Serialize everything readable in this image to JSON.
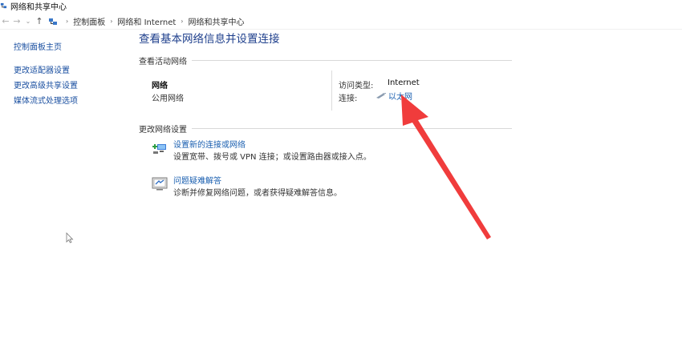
{
  "window": {
    "title": "网络和共享中心"
  },
  "address": {
    "crumbs": [
      "控制面板",
      "网络和 Internet",
      "网络和共享中心"
    ]
  },
  "sidebar": {
    "items": [
      {
        "label": "控制面板主页"
      },
      {
        "label": "更改适配器设置"
      },
      {
        "label": "更改高级共享设置"
      },
      {
        "label": "媒体流式处理选项"
      }
    ]
  },
  "main": {
    "heading": "查看基本网络信息并设置连接",
    "active_section": "查看活动网络",
    "network": {
      "name": "网络",
      "type": "公用网络",
      "access_label": "访问类型:",
      "access_value": "Internet",
      "connection_label": "连接:",
      "connection_value": "以太网"
    },
    "change_section": "更改网络设置",
    "tasks": [
      {
        "link": "设置新的连接或网络",
        "desc": "设置宽带、拨号或 VPN 连接；或设置路由器或接入点。",
        "icon": "new-connection-icon"
      },
      {
        "link": "问题疑难解答",
        "desc": "诊断并修复网络问题，或者获得疑难解答信息。",
        "icon": "troubleshoot-icon"
      }
    ]
  },
  "colors": {
    "link": "#1a5fb0",
    "heading": "#1e3f8c",
    "annotation_arrow": "#f03c3c"
  }
}
